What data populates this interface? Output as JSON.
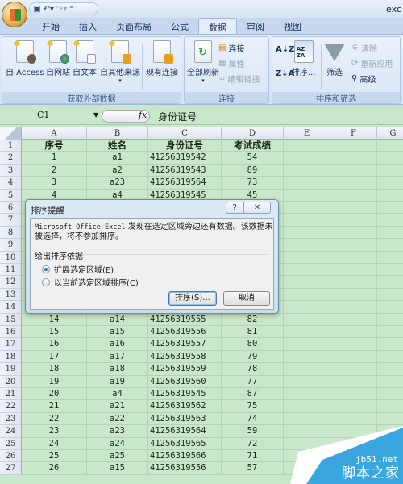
{
  "app": {
    "title": "exc"
  },
  "quick_access": {
    "icons": [
      "save-icon",
      "undo-icon",
      "redo-icon",
      "customize-icon"
    ]
  },
  "tabs": [
    {
      "label": "开始",
      "active": false
    },
    {
      "label": "插入",
      "active": false
    },
    {
      "label": "页面布局",
      "active": false
    },
    {
      "label": "公式",
      "active": false
    },
    {
      "label": "数据",
      "active": true
    },
    {
      "label": "审阅",
      "active": false
    },
    {
      "label": "视图",
      "active": false
    }
  ],
  "ribbon": {
    "groups": [
      {
        "label": "获取外部数据",
        "buttons": [
          {
            "label": "自 Access",
            "icon": "access-database-icon"
          },
          {
            "label": "自网站",
            "icon": "web-globe-icon"
          },
          {
            "label": "自文本",
            "icon": "text-file-icon"
          },
          {
            "label": "自其他来源",
            "icon": "other-sources-icon"
          },
          {
            "label": "现有连接",
            "icon": "existing-connections-icon"
          }
        ]
      },
      {
        "label": "连接",
        "buttons": [
          {
            "label": "全部刷新",
            "icon": "refresh-all-icon"
          },
          {
            "label": "连接",
            "icon": "connections-icon",
            "enabled": true
          },
          {
            "label": "属性",
            "icon": "properties-icon",
            "enabled": false
          },
          {
            "label": "编辑链接",
            "icon": "edit-links-icon",
            "enabled": false
          }
        ]
      },
      {
        "label": "排序和筛选",
        "buttons": [
          {
            "label": "",
            "icon": "sort-ascending-icon"
          },
          {
            "label": "",
            "icon": "sort-descending-icon"
          },
          {
            "label": "排序...",
            "icon": "sort-dialog-icon"
          },
          {
            "label": "筛选",
            "icon": "filter-funnel-icon"
          },
          {
            "label": "清除",
            "icon": "clear-filter-icon",
            "enabled": false
          },
          {
            "label": "重新应用",
            "icon": "reapply-icon",
            "enabled": false
          },
          {
            "label": "高级",
            "icon": "advanced-filter-icon",
            "enabled": true
          }
        ]
      }
    ]
  },
  "formula_bar": {
    "name_box": "C1",
    "fx": "fx",
    "value": "身份证号"
  },
  "columns": [
    "A",
    "B",
    "C",
    "D",
    "E",
    "F",
    "G"
  ],
  "sheet": {
    "header": {
      "row": "1",
      "cells": [
        "序号",
        "姓名",
        "身份证号",
        "考试成绩"
      ]
    },
    "rows": [
      {
        "row": "2",
        "cells": [
          "1",
          "a1",
          "41256319542",
          "54"
        ]
      },
      {
        "row": "3",
        "cells": [
          "2",
          "a2",
          "41256319543",
          "89"
        ]
      },
      {
        "row": "4",
        "cells": [
          "3",
          "a23",
          "41256319564",
          "73"
        ]
      },
      {
        "row": "5",
        "cells": [
          "4",
          "a4",
          "41256319545",
          "45"
        ]
      },
      {
        "row": "6",
        "cells": [
          "",
          "",
          "",
          ""
        ]
      },
      {
        "row": "7",
        "cells": [
          "",
          "",
          "",
          ""
        ]
      },
      {
        "row": "8",
        "cells": [
          "",
          "",
          "",
          ""
        ]
      },
      {
        "row": "9",
        "cells": [
          "",
          "",
          "",
          ""
        ]
      },
      {
        "row": "10",
        "cells": [
          "",
          "",
          "",
          ""
        ]
      },
      {
        "row": "11",
        "cells": [
          "",
          "",
          "",
          ""
        ]
      },
      {
        "row": "12",
        "cells": [
          "",
          "",
          "",
          ""
        ]
      },
      {
        "row": "13",
        "cells": [
          "",
          "",
          "",
          ""
        ]
      },
      {
        "row": "14",
        "cells": [
          "",
          "",
          "",
          ""
        ]
      },
      {
        "row": "15",
        "cells": [
          "14",
          "a14",
          "41256319555",
          "82"
        ]
      },
      {
        "row": "16",
        "cells": [
          "15",
          "a15",
          "41256319556",
          "81"
        ]
      },
      {
        "row": "17",
        "cells": [
          "16",
          "a16",
          "41256319557",
          "80"
        ]
      },
      {
        "row": "18",
        "cells": [
          "17",
          "a17",
          "41256319558",
          "79"
        ]
      },
      {
        "row": "19",
        "cells": [
          "18",
          "a18",
          "41256319559",
          "78"
        ]
      },
      {
        "row": "20",
        "cells": [
          "19",
          "a19",
          "41256319560",
          "77"
        ]
      },
      {
        "row": "21",
        "cells": [
          "20",
          "a4",
          "41256319545",
          "87"
        ]
      },
      {
        "row": "22",
        "cells": [
          "21",
          "a21",
          "41256319562",
          "75"
        ]
      },
      {
        "row": "23",
        "cells": [
          "22",
          "a22",
          "41256319563",
          "74"
        ]
      },
      {
        "row": "24",
        "cells": [
          "23",
          "a23",
          "41256319564",
          "59"
        ]
      },
      {
        "row": "25",
        "cells": [
          "24",
          "a24",
          "41256319565",
          "72"
        ]
      },
      {
        "row": "26",
        "cells": [
          "25",
          "a25",
          "41256319566",
          "71"
        ]
      },
      {
        "row": "27",
        "cells": [
          "26",
          "a15",
          "41256319556",
          "57"
        ]
      }
    ]
  },
  "dialog": {
    "title": "排序提醒",
    "help_label": "?",
    "close_label": "✕",
    "message_prefix": "Microsoft Office Excel",
    "message": " 发现在选定区域旁边还有数据。该数据未被选择，将不参加排序。",
    "group_label": "给出排序依据",
    "options": [
      {
        "label": "扩展选定区域(E)",
        "selected": true
      },
      {
        "label": "以当前选定区域排序(C)",
        "selected": false
      }
    ],
    "sort_button": "排序(S)...",
    "cancel_button": "取消"
  },
  "watermark": {
    "site": "jb51.net",
    "name": "脚本之家",
    "color": "#3aa6e0"
  }
}
